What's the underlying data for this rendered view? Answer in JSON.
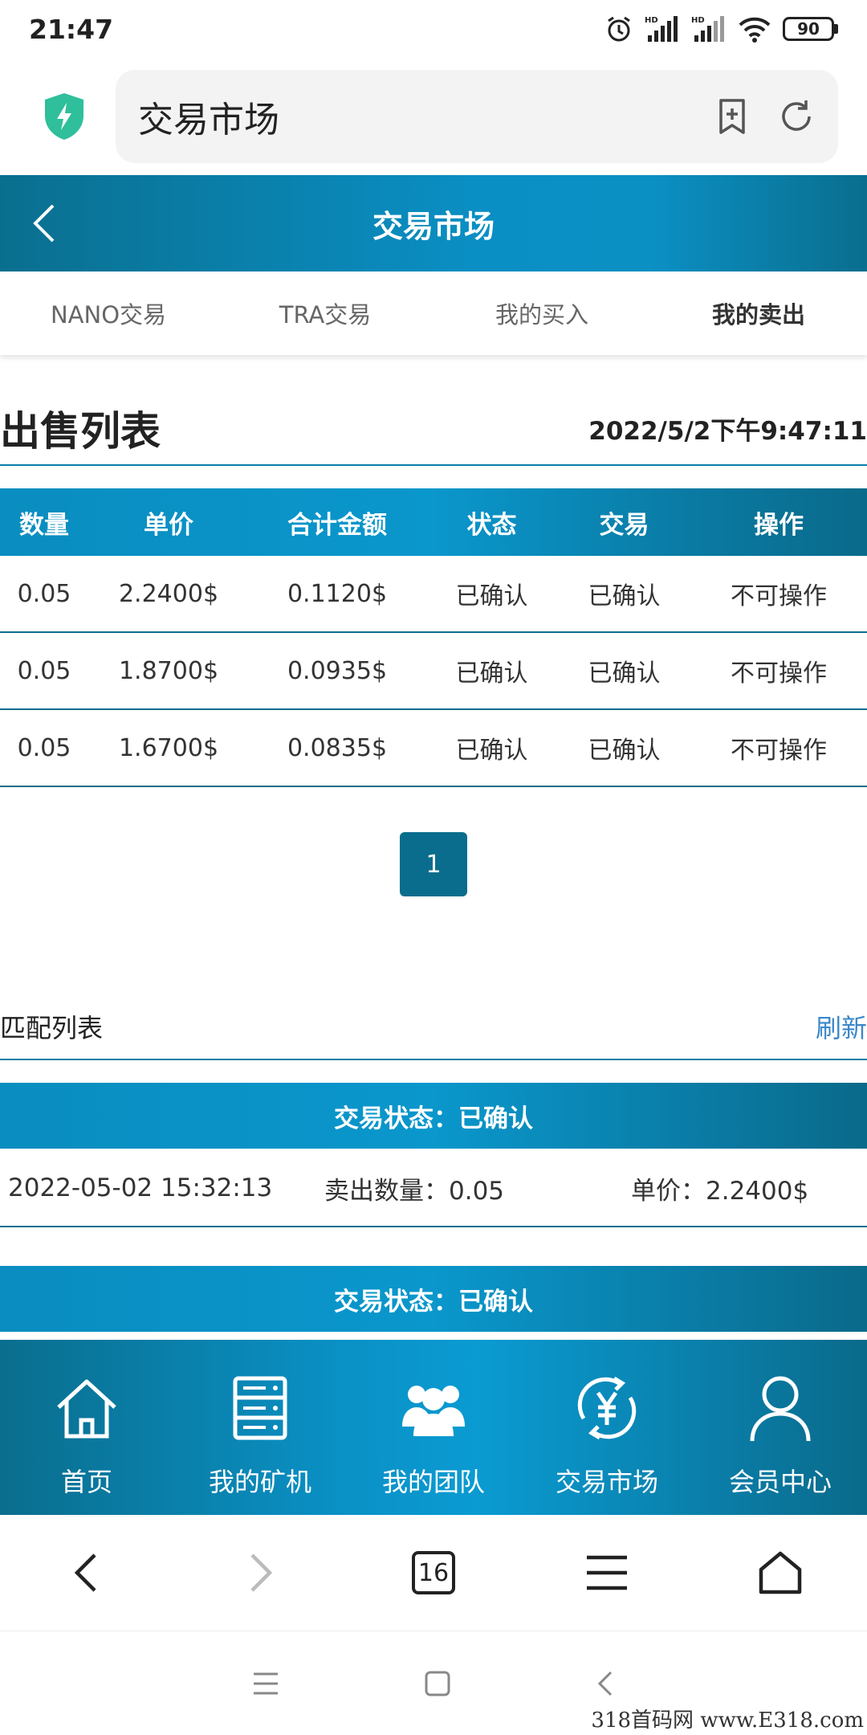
{
  "status_bar": {
    "time": "21:47",
    "battery": "90"
  },
  "browser": {
    "address_text": "交易市场",
    "tabs_count": "16"
  },
  "header": {
    "title": "交易市场"
  },
  "tabs": [
    {
      "label": "NANO交易"
    },
    {
      "label": "TRA交易"
    },
    {
      "label": "我的买入"
    },
    {
      "label": "我的卖出",
      "active": true
    }
  ],
  "sales": {
    "title": "出售列表",
    "timestamp": "2022/5/2下午9:47:11",
    "columns": [
      "数量",
      "单价",
      "合计金额",
      "状态",
      "交易",
      "操作"
    ],
    "rows": [
      [
        "0.05",
        "2.2400$",
        "0.1120$",
        "已确认",
        "已确认",
        "不可操作"
      ],
      [
        "0.05",
        "1.8700$",
        "0.0935$",
        "已确认",
        "已确认",
        "不可操作"
      ],
      [
        "0.05",
        "1.6700$",
        "0.0835$",
        "已确认",
        "已确认",
        "不可操作"
      ]
    ],
    "page": "1"
  },
  "matching": {
    "title": "匹配列表",
    "refresh_label": "刷新",
    "items": [
      {
        "status": "交易状态：已确认",
        "time": "2022-05-02 15:32:13",
        "qty": "卖出数量：0.05",
        "price": "单价：2.2400$"
      },
      {
        "status": "交易状态：已确认"
      }
    ]
  },
  "app_nav": [
    {
      "label": "首页",
      "icon": "home-icon"
    },
    {
      "label": "我的矿机",
      "icon": "server-icon"
    },
    {
      "label": "我的团队",
      "icon": "team-icon"
    },
    {
      "label": "交易市场",
      "icon": "yen-exchange-icon"
    },
    {
      "label": "会员中心",
      "icon": "user-icon"
    }
  ],
  "watermark": "318首码网 www.E318.com",
  "colors": {
    "primary": "#0a8dc0",
    "dark": "#0a6d8d",
    "link": "#3a87c8"
  }
}
